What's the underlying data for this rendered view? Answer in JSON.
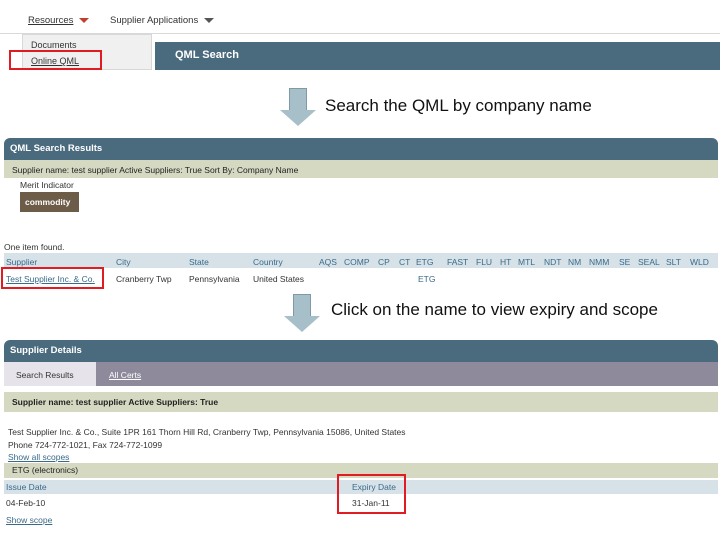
{
  "nav": {
    "resources": "Resources",
    "supplier_applications": "Supplier Applications",
    "dropdown_items": [
      "Documents",
      "Online QML"
    ]
  },
  "qml_bar": {
    "title": "QML Search"
  },
  "captions": {
    "step1": "Search the QML by company name",
    "step2": "Click on the name to view expiry and scope"
  },
  "results": {
    "header": "QML Search Results",
    "info": "Supplier name: test supplier Active Suppliers: True Sort By: Company Name",
    "merit_label": "Merit Indicator",
    "commodity": "commodity",
    "count": "One item found.",
    "columns": [
      "Supplier",
      "City",
      "State",
      "Country",
      "AQS",
      "COMP",
      "CP",
      "CT",
      "ETG",
      "FAST",
      "FLU",
      "HT",
      "MTL",
      "NDT",
      "NM",
      "NMM",
      "SE",
      "SEAL",
      "SLT",
      "WLD"
    ],
    "row": {
      "supplier": "Test Supplier Inc. & Co.",
      "city": "Cranberry Twp",
      "state": "Pennsylvania",
      "country": "United States",
      "etg": "ETG"
    }
  },
  "details": {
    "header": "Supplier Details",
    "tab_active": "Search Results",
    "tab_other": "All Certs",
    "info": "Supplier name: test supplier Active Suppliers: True",
    "address": "Test Supplier Inc. & Co., Suite 1PR 161 Thorn Hill Rd, Cranberry Twp, Pennsylvania 15086, United States",
    "phone": "Phone 724-772-1021, Fax 724-772-1099",
    "show_all_scopes": "Show all scopes",
    "section": "ETG (electronics)",
    "col_issue": "Issue Date",
    "col_expiry": "Expiry Date",
    "issue_date": "04-Feb-10",
    "expiry_date": "31-Jan-11",
    "show_scope": "Show scope"
  },
  "colors": {
    "header_bg": "#4a6a7e",
    "highlight": "#e11b22",
    "arrow": "#a6bfc8",
    "info_bar": "#d6d9c2",
    "commodity": "#6d5c47"
  }
}
